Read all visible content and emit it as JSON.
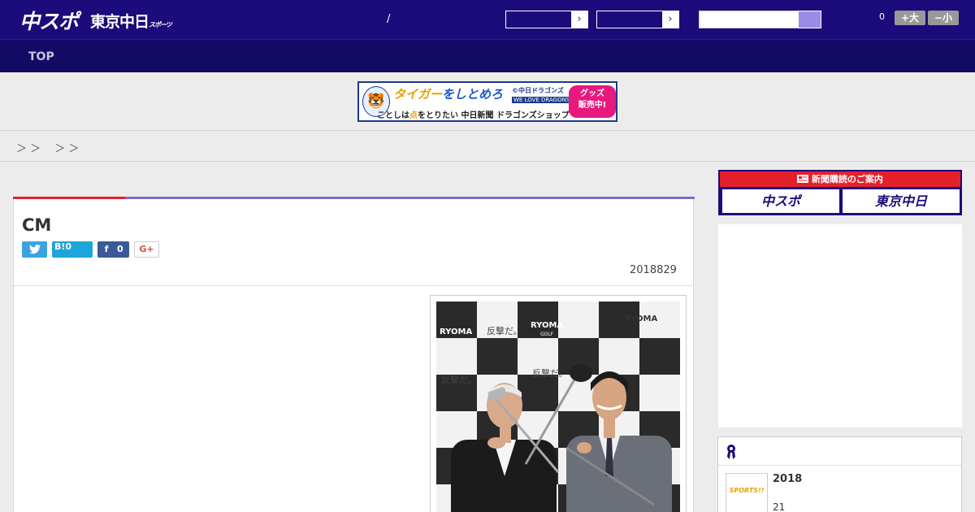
{
  "header": {
    "logo_main": "中スポ",
    "logo_sub": "東京中日",
    "logo_sub_small": "スポーツ",
    "separator": "/",
    "select_arrow_1": "›",
    "select_arrow_2": "›",
    "zoom_count": "0",
    "zoom_in_label": "+大",
    "zoom_out_label": "−小"
  },
  "nav": {
    "top_label": "TOP"
  },
  "banner": {
    "mascot": "🐯",
    "line1_a": "タイガー",
    "line1_b": "をしとめろ",
    "dragons_a": "©中日ドラゴンズ",
    "dragons_b": "WE LOVE DRAGONS",
    "line2_a": "ことしは",
    "line2_b": "点",
    "line2_c": "をとりたい 中日新聞 ドラゴンズショップ",
    "goods_a": "グッズ",
    "goods_b": "販売中!"
  },
  "breadcrumb": {
    "text": "＞ ＞　 ＞ ＞"
  },
  "article": {
    "title": "CM",
    "share_twitter_icon": "🐦",
    "share_hatena_label": "B!0",
    "share_fb_icon": "f",
    "share_fb_count": "0",
    "share_gplus_label": "G+",
    "date": "2018829",
    "photo_text_brand": "RYOMA",
    "photo_text_golf": "GOLF",
    "photo_text_slogan": "反撃だ。"
  },
  "sidebar": {
    "subscribe_header": "新聞購読のご案内",
    "subscribe_btn_1": "中スポ",
    "subscribe_btn_2": "東京中日",
    "ranking_item_title": "2018",
    "ranking_item_sub": "21",
    "ranking_thumb_text": "SPORTS!!"
  },
  "colors": {
    "header_bg": "#1c0b7a",
    "nav_bg": "#130a63",
    "accent_red": "#e4202d",
    "accent_purple": "#7a6cc6"
  }
}
